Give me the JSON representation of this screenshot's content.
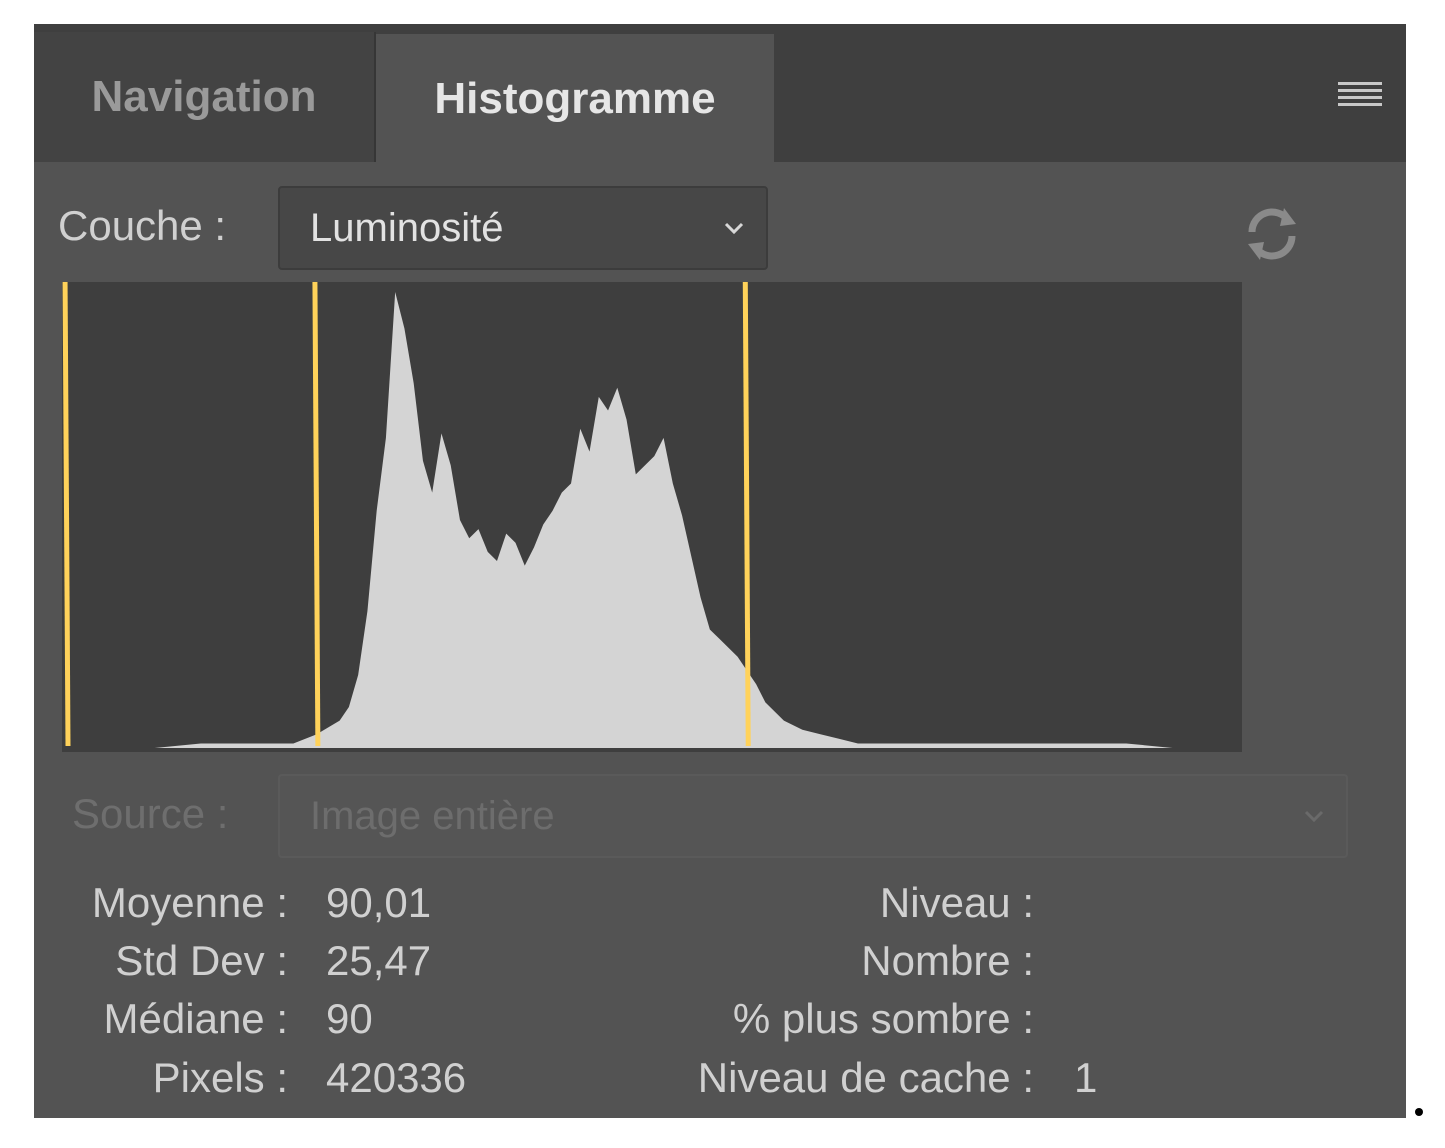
{
  "tabs": [
    {
      "label": "Navigation",
      "active": false
    },
    {
      "label": "Histogramme",
      "active": true
    }
  ],
  "channel": {
    "label": "Couche :",
    "value": "Luminosité"
  },
  "source": {
    "label": "Source :",
    "value": "Image entière",
    "disabled": true
  },
  "stats_left": [
    {
      "label": "Moyenne :",
      "value": "90,01"
    },
    {
      "label": "Std Dev :",
      "value": "25,47"
    },
    {
      "label": "Médiane :",
      "value": "90"
    },
    {
      "label": "Pixels :",
      "value": "420336"
    }
  ],
  "stats_right": [
    {
      "label": "Niveau :",
      "value": ""
    },
    {
      "label": "Nombre :",
      "value": ""
    },
    {
      "label": "% plus sombre :",
      "value": ""
    },
    {
      "label": "Niveau de cache :",
      "value": "1"
    }
  ],
  "colors": {
    "panel_bg": "#535353",
    "tabbar_bg": "#3f3f3f",
    "histogram_bg": "#3e3e3e",
    "histogram_fill": "#d4d4d4",
    "marker": "#ffd25a",
    "text": "#d0d0d0"
  },
  "icons": {
    "menu": "hamburger-menu-icon",
    "refresh": "refresh-icon",
    "dropdown": "chevron-down-icon"
  },
  "chart_data": {
    "type": "area",
    "x": [
      0,
      10,
      20,
      30,
      40,
      50,
      55,
      60,
      62,
      64,
      66,
      68,
      70,
      72,
      74,
      76,
      78,
      80,
      82,
      84,
      86,
      88,
      90,
      92,
      94,
      96,
      98,
      100,
      102,
      104,
      106,
      108,
      110,
      112,
      114,
      116,
      118,
      120,
      122,
      124,
      126,
      128,
      130,
      132,
      134,
      136,
      138,
      140,
      142,
      144,
      146,
      148,
      150,
      152,
      156,
      160,
      164,
      168,
      172,
      176,
      180,
      185,
      190,
      200,
      205,
      210,
      215,
      220,
      225,
      230,
      240,
      250
    ],
    "values": [
      0,
      0,
      0,
      1,
      1,
      1,
      3,
      6,
      9,
      16,
      30,
      52,
      68,
      100,
      92,
      80,
      63,
      56,
      69,
      62,
      50,
      46,
      48,
      43,
      41,
      47,
      45,
      40,
      44,
      49,
      52,
      56,
      58,
      70,
      65,
      77,
      74,
      79,
      72,
      60,
      62,
      64,
      68,
      58,
      51,
      42,
      33,
      26,
      24,
      22,
      20,
      17,
      14,
      10,
      6,
      4,
      3,
      2,
      1,
      1,
      1,
      1,
      1,
      1,
      1,
      1,
      1,
      1,
      1,
      1,
      0,
      0
    ],
    "xlim": [
      0,
      255
    ],
    "ylim": [
      0,
      100
    ],
    "grid": false,
    "markers": [
      0,
      54,
      147
    ]
  }
}
